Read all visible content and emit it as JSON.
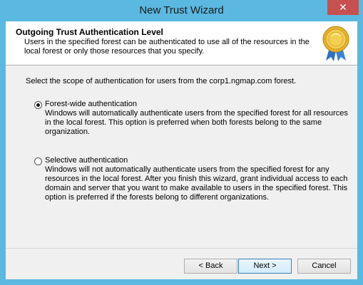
{
  "window": {
    "title": "New Trust Wizard",
    "close_glyph": "✕"
  },
  "header": {
    "title": "Outgoing Trust Authentication Level",
    "description": "Users in the specified forest can be authenticated to use all of the resources in the local forest or only those resources that you specify.",
    "icon": "certificate-seal-icon"
  },
  "main": {
    "scope_label": "Select the scope of authentication for users from the corp1.ngmap.com forest.",
    "options": [
      {
        "label": "Forest-wide authentication",
        "selected": true,
        "description": "Windows will automatically authenticate users from the specified forest for all resources in the local forest. This option is preferred when both forests belong to the same organization."
      },
      {
        "label": "Selective authentication",
        "selected": false,
        "description": "Windows will not automatically authenticate users from the specified forest for any resources in the local forest. After you finish this wizard, grant individual access to each domain and server that you want to make available to users in the specified forest. This option is preferred if the forests belong to different organizations."
      }
    ]
  },
  "footer": {
    "back_label": "< Back",
    "next_label": "Next >",
    "cancel_label": "Cancel"
  },
  "colors": {
    "titlebar": "#5bb8e0",
    "close_button": "#c75050",
    "dialog_bg": "#f0f0f0",
    "default_button_border": "#3c7fb1"
  }
}
